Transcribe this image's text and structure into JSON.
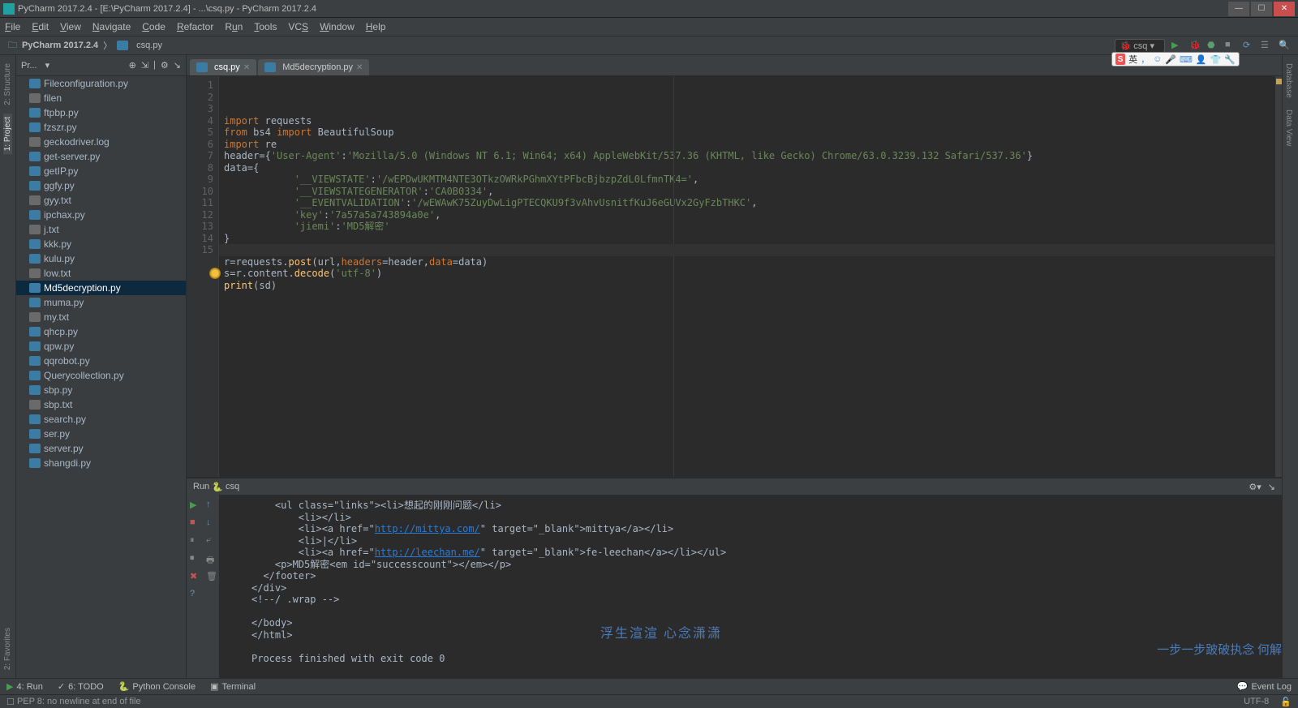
{
  "title": "PyCharm 2017.2.4 - [E:\\PyCharm 2017.2.4] - ...\\csq.py - PyCharm 2017.2.4",
  "menu": [
    "File",
    "Edit",
    "View",
    "Navigate",
    "Code",
    "Refactor",
    "Run",
    "Tools",
    "VCS",
    "Window",
    "Help"
  ],
  "breadcrumb": {
    "root": "PyCharm 2017.2.4",
    "file": "csq.py"
  },
  "runconfig": "csq",
  "project": {
    "header": "Pr...",
    "files": [
      {
        "n": "Fileconfiguration.py",
        "t": "py"
      },
      {
        "n": "filen",
        "t": "txt"
      },
      {
        "n": "ftpbp.py",
        "t": "py"
      },
      {
        "n": "fzszr.py",
        "t": "py"
      },
      {
        "n": "geckodriver.log",
        "t": "log"
      },
      {
        "n": "get-server.py",
        "t": "py"
      },
      {
        "n": "getIP.py",
        "t": "py"
      },
      {
        "n": "ggfy.py",
        "t": "py"
      },
      {
        "n": "gyy.txt",
        "t": "txt"
      },
      {
        "n": "ipchax.py",
        "t": "py"
      },
      {
        "n": "j.txt",
        "t": "txt"
      },
      {
        "n": "kkk.py",
        "t": "py"
      },
      {
        "n": "kulu.py",
        "t": "py"
      },
      {
        "n": "low.txt",
        "t": "txt"
      },
      {
        "n": "Md5decryption.py",
        "t": "py",
        "sel": true
      },
      {
        "n": "muma.py",
        "t": "py"
      },
      {
        "n": "my.txt",
        "t": "txt"
      },
      {
        "n": "qhcp.py",
        "t": "py"
      },
      {
        "n": "qpw.py",
        "t": "py"
      },
      {
        "n": "qqrobot.py",
        "t": "py"
      },
      {
        "n": "Querycollection.py",
        "t": "py"
      },
      {
        "n": "sbp.py",
        "t": "py"
      },
      {
        "n": "sbp.txt",
        "t": "txt"
      },
      {
        "n": "search.py",
        "t": "py"
      },
      {
        "n": "ser.py",
        "t": "py"
      },
      {
        "n": "server.py",
        "t": "py"
      },
      {
        "n": "shangdi.py",
        "t": "py"
      }
    ]
  },
  "tabs": [
    {
      "label": "csq.py",
      "active": true
    },
    {
      "label": "Md5decryption.py",
      "active": false
    }
  ],
  "code_lines": 15,
  "run": {
    "label": "Run",
    "name": "csq",
    "exit": "Process finished with exit code 0"
  },
  "bottom": [
    "4: Run",
    "6: TODO",
    "Python Console",
    "Terminal",
    "Event Log"
  ],
  "status": {
    "msg": "PEP 8: no newline at end of file",
    "enc": "UTF-8"
  },
  "side_left": [
    "2: Structure",
    "1: Project",
    "2: Favorites"
  ],
  "side_right": [
    "Database",
    "Data View"
  ],
  "ime": "英",
  "watermark": "浮生渲渲    心念潇潇",
  "watermark2": "一步一步跛破执念 何解"
}
